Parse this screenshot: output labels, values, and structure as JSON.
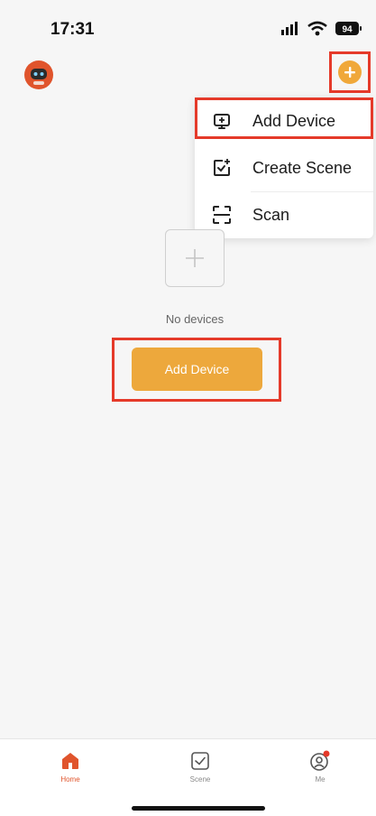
{
  "status_bar": {
    "time": "17:31",
    "battery": "94"
  },
  "header": {
    "avatar_icon": "robot-avatar-icon",
    "add_icon": "plus-circle-icon",
    "accent_color": "#f0a83a"
  },
  "menu": {
    "items": [
      {
        "label": "Add Device",
        "icon": "add-device-icon"
      },
      {
        "label": "Create Scene",
        "icon": "create-scene-icon"
      },
      {
        "label": "Scan",
        "icon": "scan-icon"
      }
    ]
  },
  "empty_state": {
    "message": "No devices",
    "button_label": "Add Device",
    "icon": "plus-box-icon"
  },
  "tabbar": {
    "tabs": [
      {
        "label": "Home",
        "icon": "home-icon",
        "active": true
      },
      {
        "label": "Scene",
        "icon": "scene-checkbox-icon",
        "active": false
      },
      {
        "label": "Me",
        "icon": "user-icon",
        "active": false,
        "badge": true
      }
    ],
    "active_color": "#e0542c"
  },
  "highlight_color": "#e53a2a"
}
